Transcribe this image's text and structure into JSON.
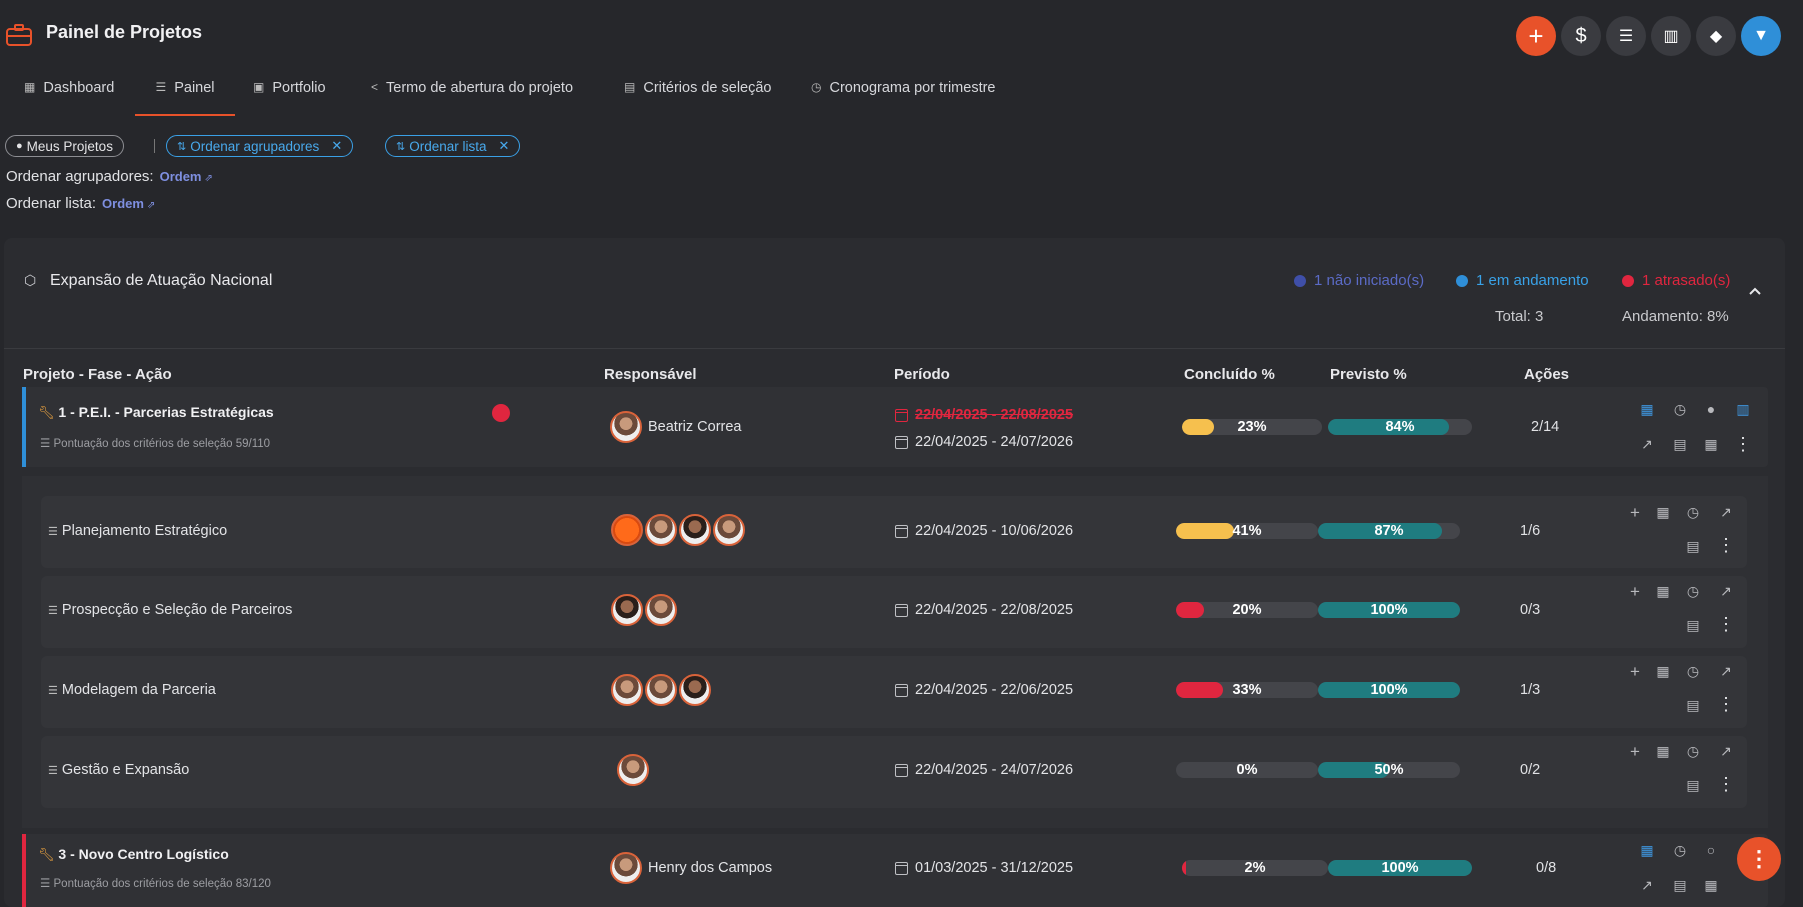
{
  "header": {
    "title": "Painel de Projetos"
  },
  "toolbar": [
    "add-icon",
    "dollar-icon",
    "checklist-icon",
    "book-icon",
    "tag-icon",
    "filter-icon"
  ],
  "tabs": [
    {
      "label": "Dashboard",
      "icon": "grid-icon"
    },
    {
      "label": "Painel",
      "icon": "list-icon",
      "active": true
    },
    {
      "label": "Portfolio",
      "icon": "portfolio-icon"
    },
    {
      "label": "Termo de abertura do projeto",
      "icon": "share-icon"
    },
    {
      "label": "Critérios de seleção",
      "icon": "doc-icon"
    },
    {
      "label": "Cronograma por trimestre",
      "icon": "clock-icon"
    }
  ],
  "filters": {
    "mine": "Meus Projetos",
    "chip1": "Ordenar agrupadores",
    "chip2": "Ordenar lista"
  },
  "sort": {
    "groups_label": "Ordenar agrupadores:",
    "groups_value": "Ordem",
    "list_label": "Ordenar lista:",
    "list_value": "Ordem"
  },
  "group": {
    "title": "Expansão de Atuação Nacional",
    "legend": {
      "not_started": "1 não iniciado(s)",
      "in_progress": "1 em andamento",
      "late": "1 atrasado(s)"
    },
    "total": "Total: 3",
    "progress": "Andamento: 8%"
  },
  "columns": {
    "project": "Projeto - Fase - Ação",
    "owner": "Responsável",
    "period": "Período",
    "done": "Concluído %",
    "planned": "Previsto %",
    "actions": "Ações"
  },
  "colors": {
    "accent": "#e8522a",
    "blue": "#2f8fd8",
    "yellow": "#f6c04e",
    "red": "#e0263f",
    "teal": "#1f7c80",
    "indigo": "#3f4fa8"
  },
  "projects": [
    {
      "name": "1 - P.E.I. - Parcerias Estratégicas",
      "score": "Pontuação dos critérios de seleção 59/110",
      "owner": "Beatriz Correa",
      "period_old": "22/04/2025 - 22/08/2025",
      "period": "22/04/2025 - 24/07/2026",
      "done_label": "23%",
      "done": 23,
      "planned_label": "84%",
      "planned": 84,
      "ratio": "2/14"
    },
    {
      "name": "3 - Novo Centro Logístico",
      "score": "Pontuação dos critérios de seleção 83/120",
      "owner": "Henry dos Campos",
      "period": "01/03/2025 - 31/12/2025",
      "done_label": "2%",
      "done": 2,
      "planned_label": "100%",
      "planned": 100,
      "ratio": "0/8"
    }
  ],
  "phases": [
    {
      "name": "Planejamento Estratégico",
      "period": "22/04/2025 - 10/06/2026",
      "done_label": "41%",
      "done": 41,
      "planned_label": "87%",
      "planned": 87,
      "ratio": "1/6"
    },
    {
      "name": "Prospecção e Seleção de Parceiros",
      "period": "22/04/2025 - 22/08/2025",
      "done_label": "20%",
      "done": 20,
      "planned_label": "100%",
      "planned": 100,
      "ratio": "0/3"
    },
    {
      "name": "Modelagem da Parceria",
      "period": "22/04/2025 - 22/06/2025",
      "done_label": "33%",
      "done": 33,
      "planned_label": "100%",
      "planned": 100,
      "ratio": "1/3"
    },
    {
      "name": "Gestão e Expansão",
      "period": "22/04/2025 - 24/07/2026",
      "done_label": "0%",
      "done": 0,
      "planned_label": "50%",
      "planned": 50,
      "ratio": "0/2"
    }
  ]
}
